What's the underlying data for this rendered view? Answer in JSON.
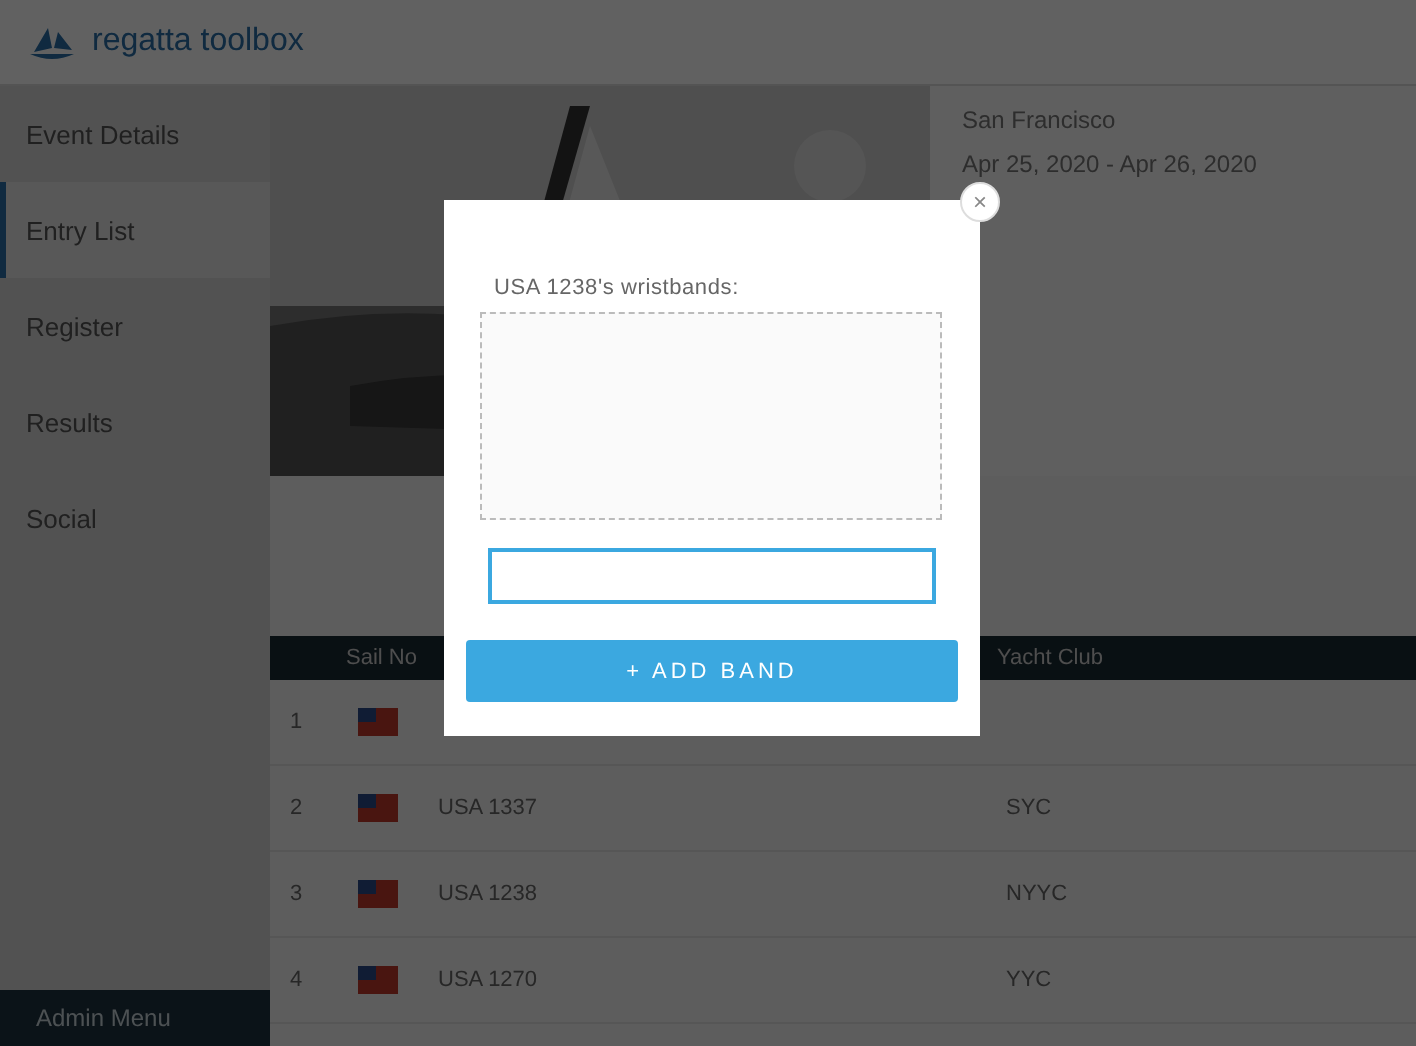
{
  "brand": "regatta toolbox",
  "sidebar": {
    "items": [
      {
        "label": "Event Details",
        "selected": false
      },
      {
        "label": "Entry List",
        "selected": true
      },
      {
        "label": "Register",
        "selected": false
      },
      {
        "label": "Results",
        "selected": false
      },
      {
        "label": "Social",
        "selected": false
      }
    ],
    "admin_menu": "Admin Menu"
  },
  "event": {
    "location": "San Francisco",
    "dates": "Apr 25, 2020 - Apr 26, 2020"
  },
  "table": {
    "columns": [
      "Sail No",
      "Yacht Club"
    ],
    "rows": [
      {
        "number": "1"
      },
      {
        "number": "2",
        "sail": "USA 1337",
        "club": "SYC"
      },
      {
        "number": "3",
        "sail": "USA 1238",
        "club": "NYYC"
      },
      {
        "number": "4",
        "sail": "USA 1270",
        "club": "YYC"
      }
    ]
  },
  "modal": {
    "title": "USA 1238's wristbands:",
    "button": "+ ADD BAND",
    "close": "×"
  }
}
